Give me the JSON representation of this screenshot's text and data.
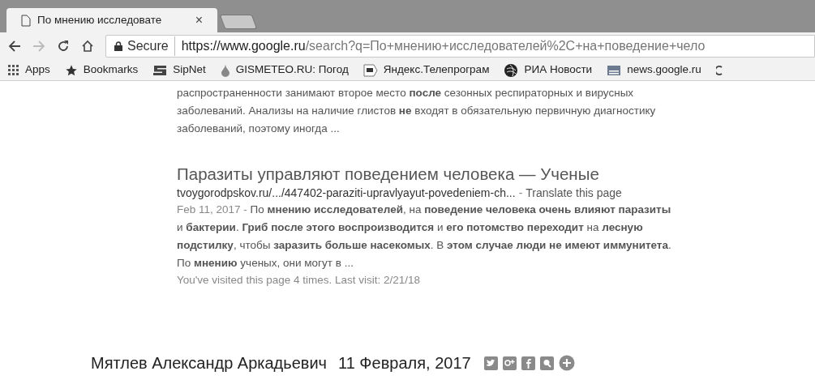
{
  "tabs": [
    {
      "title": "По мнению исследовате",
      "close": "×",
      "selected": true
    }
  ],
  "toolbar": {
    "secure_label": "Secure",
    "url_host": "https://www.google.ru",
    "url_path": "/search?q=По+мнению+исследователей%2C+на+поведение+чело"
  },
  "bookmarks": [
    {
      "kind": "apps",
      "label": "Apps"
    },
    {
      "kind": "star",
      "label": "Bookmarks"
    },
    {
      "kind": "sipnet",
      "label": "SipNet"
    },
    {
      "kind": "drop",
      "label": "GISMETEO.RU: Погод"
    },
    {
      "kind": "tv",
      "label": "Яндекс.Телепрограм"
    },
    {
      "kind": "ria",
      "label": "РИА Новости"
    },
    {
      "kind": "news",
      "label": "news.google.ru"
    },
    {
      "kind": "partial"
    }
  ],
  "results": [
    {
      "kind": "tail",
      "lines": [
        "распространенности занимают второе место **после** сезонных респираторных и вирусных заболеваний. Анализы на наличие глистов **не** входят в обязательную первичную диагностику заболеваний, поэтому иногда ..."
      ]
    },
    {
      "kind": "full",
      "title": "Паразиты управляют поведением человека — Ученые",
      "url": "tvoygorodpskov.ru/.../447402-paraziti-upravlyayut-povedeniem-ch...",
      "separator": "-",
      "translate": "Translate this page",
      "date": "Feb 11, 2017",
      "date_separator": "-",
      "snippet": "По **мнению исследователей**, на **поведение человека очень влияют паразиты** и **бактерии**. **Гриб после этого воспроизводится** и **его потомство переходит** на **лесную подстилку**, чтобы **заразить больше насекомых**. В **этом случае люди не имеют иммунитета**. По **мнению** ученых, они могут в ...",
      "visited": "You've visited this page 4 times. Last visit: 2/21/18"
    }
  ],
  "byline": {
    "author": "Мятлев Александр Аркадьевич",
    "date": "11 Февраля, 2017",
    "share": [
      {
        "kind": "twitter"
      },
      {
        "kind": "gplus"
      },
      {
        "kind": "facebook"
      },
      {
        "kind": "search"
      },
      {
        "kind": "plus"
      }
    ]
  }
}
